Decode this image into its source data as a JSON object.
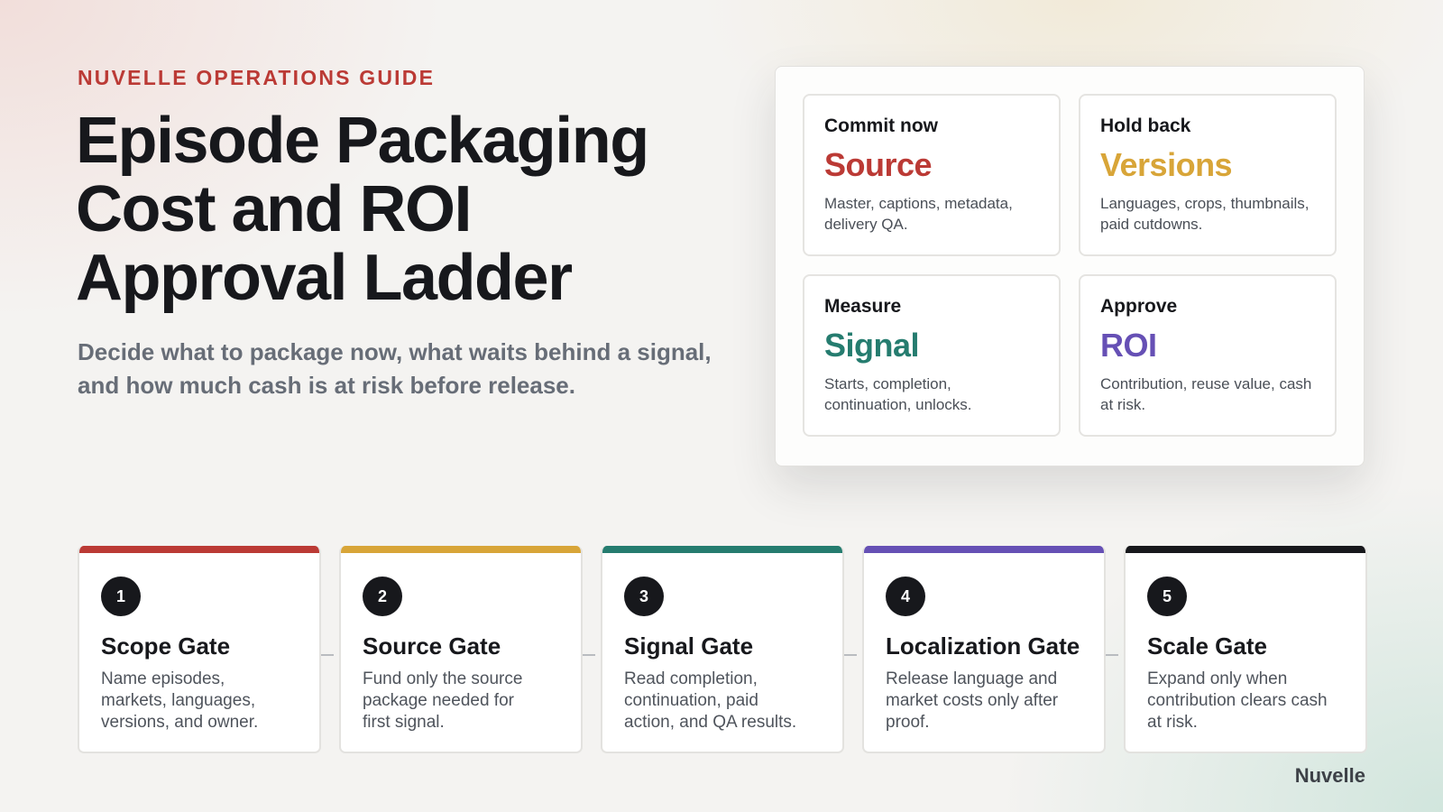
{
  "header": {
    "eyebrow": "NUVELLE OPERATIONS GUIDE",
    "title_lines": [
      "Episode Packaging",
      "Cost and ROI",
      "Approval Ladder"
    ],
    "subtitle": "Decide what to package now, what waits behind a signal, and how much cash is at risk before release."
  },
  "quadrant": [
    {
      "kicker": "Commit now",
      "word": "Source",
      "desc": "Master, captions, metadata, delivery QA.",
      "color": "#bb3a35"
    },
    {
      "kicker": "Hold back",
      "word": "Versions",
      "desc": "Languages, crops, thumbnails, paid cutdowns.",
      "color": "#d8a538"
    },
    {
      "kicker": "Measure",
      "word": "Signal",
      "desc": "Starts, completion, continuation, unlocks.",
      "color": "#257c6f"
    },
    {
      "kicker": "Approve",
      "word": "ROI",
      "desc": "Contribution, reuse value, cash at risk.",
      "color": "#6650b5"
    }
  ],
  "steps": [
    {
      "num": "1",
      "title": "Scope Gate",
      "desc": "Name episodes, markets, languages, versions, and owner.",
      "color": "#bb3a35"
    },
    {
      "num": "2",
      "title": "Source Gate",
      "desc": "Fund only the source package needed for first signal.",
      "color": "#d8a538"
    },
    {
      "num": "3",
      "title": "Signal Gate",
      "desc": "Read completion, continuation, paid action, and QA results.",
      "color": "#257c6f"
    },
    {
      "num": "4",
      "title": "Localization Gate",
      "desc": "Release language and market costs only after proof.",
      "color": "#6650b5"
    },
    {
      "num": "5",
      "title": "Scale Gate",
      "desc": "Expand only when contribution clears cash at risk.",
      "color": "#17181c"
    }
  ],
  "brand": "Nuvelle"
}
